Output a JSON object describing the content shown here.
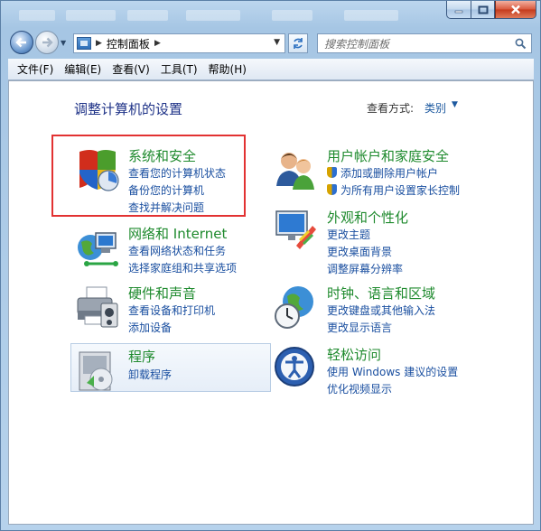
{
  "window": {
    "address": {
      "breadcrumb": "控制面板"
    },
    "search": {
      "placeholder": "搜索控制面板"
    }
  },
  "menu": [
    "文件(F)",
    "编辑(E)",
    "查看(V)",
    "工具(T)",
    "帮助(H)"
  ],
  "page": {
    "title": "调整计算机的设置",
    "view_by_label": "查看方式:",
    "view_by_value": "类别"
  },
  "categories": [
    {
      "title": "系统和安全",
      "icon": "shield-icon",
      "links": [
        "查看您的计算机状态",
        "备份您的计算机",
        "查找并解决问题"
      ]
    },
    {
      "title": "网络和 Internet",
      "icon": "network-icon",
      "links": [
        "查看网络状态和任务",
        "选择家庭组和共享选项"
      ]
    },
    {
      "title": "硬件和声音",
      "icon": "printer-icon",
      "links": [
        "查看设备和打印机",
        "添加设备"
      ]
    },
    {
      "title": "程序",
      "icon": "programs-icon",
      "links": [
        "卸载程序"
      ]
    },
    {
      "title": "用户帐户和家庭安全",
      "icon": "users-icon",
      "links": [
        "添加或删除用户帐户",
        "为所有用户设置家长控制"
      ]
    },
    {
      "title": "外观和个性化",
      "icon": "monitor-icon",
      "links": [
        "更改主题",
        "更改桌面背景",
        "调整屏幕分辨率"
      ]
    },
    {
      "title": "时钟、语言和区域",
      "icon": "clock-globe-icon",
      "links": [
        "更改键盘或其他输入法",
        "更改显示语言"
      ]
    },
    {
      "title": "轻松访问",
      "icon": "accessibility-icon",
      "links": [
        "使用 Windows 建议的设置",
        "优化视频显示"
      ]
    }
  ],
  "colors": {
    "category_title": "#1e8a2d",
    "link": "#1a4fa0",
    "highlight": "#e23232"
  }
}
